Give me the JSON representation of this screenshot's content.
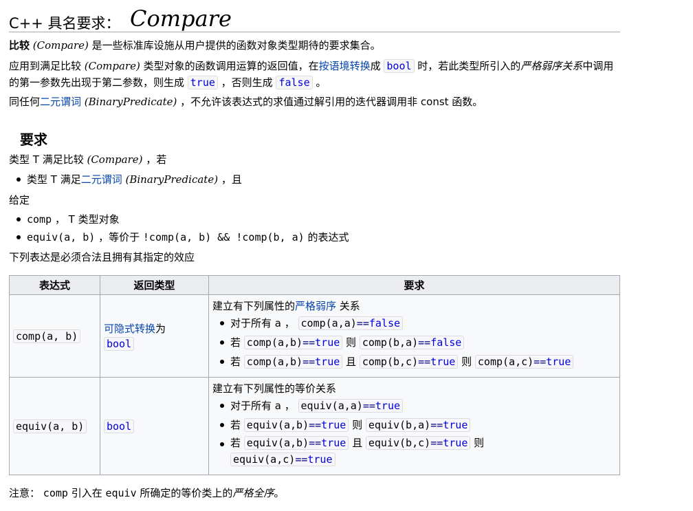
{
  "title": {
    "prefix": "C++ 具名要求：",
    "main": "Compare"
  },
  "intro": {
    "p1_bold": "比较",
    "p1_it": "(Compare)",
    "p1_rest": " 是一些标准库设施从用户提供的函数对象类型期待的要求集合。",
    "p2_a": "应用到满足比较 ",
    "p2_it": "(Compare)",
    "p2_b": " 类型对象的函数调用运算的返回值，在",
    "p2_link": "按语境转换",
    "p2_c": "成 ",
    "p2_bool": "bool",
    "p2_d": " 时，若此类型所引入的",
    "p2_em": "严格弱序关系",
    "p2_e": "中调用的第一参数先出现于第二参数，则生成 ",
    "p2_true": "true",
    "p2_f": " ，否则生成 ",
    "p2_false": "false",
    "p2_g": " 。",
    "p3_a": "同任何",
    "p3_link": "二元谓词",
    "p3_it": " (BinaryPredicate)",
    "p3_b": " ，不允许该表达式的求值通过解引用的迭代器调用非 const 函数。"
  },
  "requirements": {
    "heading": "要求",
    "line1_a": "类型 T 满足比较 ",
    "line1_it": "(Compare)",
    "line1_b": " ，若",
    "bullet1_a": "类型 T 满足",
    "bullet1_link": "二元谓词",
    "bullet1_it": " (BinaryPredicate)",
    "bullet1_b": " ，且",
    "given": "给定",
    "g1_code": "comp",
    "g1_text": " ， T 类型对象",
    "g2_code": "equiv(a, b)",
    "g2_text": " ，等价于 ",
    "g2_code2": "!comp(a, b) && !comp(b, a)",
    "g2_tail": " 的表达式",
    "lead": "下列表达是必须合法且拥有其指定的效应"
  },
  "table": {
    "headers": [
      "表达式",
      "返回类型",
      "要求"
    ],
    "row1": {
      "expr_fn": "comp",
      "expr_args": "(a, b)",
      "ret_link": "可隐式转换",
      "ret_tail": "为",
      "ret_type": "bool",
      "lead_a": "建立有下列属性的",
      "lead_link": "严格弱序",
      "lead_b": " 关系",
      "i1_text": "对于所有 a ，",
      "i1_fn": "comp",
      "i1_args": "(a,a)",
      "i1_op": "==",
      "i1_val": "false",
      "i2_pre": "若",
      "i2_fn": "comp",
      "i2_args": "(a,b)",
      "i2_op": "==",
      "i2_val": "true",
      "i2_mid": "则",
      "i2_fn2": "comp",
      "i2_args2": "(b,a)",
      "i2_op2": "==",
      "i2_val2": "false",
      "i3_pre": "若",
      "i3_fn": "comp",
      "i3_args": "(a,b)",
      "i3_op": "==",
      "i3_val": "true",
      "i3_mid": "且",
      "i3_fn2": "comp",
      "i3_args2": "(b,c)",
      "i3_op2": "==",
      "i3_val2": "true",
      "i3_mid2": "则",
      "i3_fn3": "comp",
      "i3_args3": "(a,c)",
      "i3_op3": "==",
      "i3_val3": "true"
    },
    "row2": {
      "expr_fn": "equiv",
      "expr_args": "(a, b)",
      "ret_type": "bool",
      "lead": "建立有下列属性的等价关系",
      "i1_text": "对于所有 a ，",
      "i1_fn": "equiv",
      "i1_args": "(a,a)",
      "i1_op": "==",
      "i1_val": "true",
      "i2_pre": "若",
      "i2_fn": "equiv",
      "i2_args": "(a,b)",
      "i2_op": "==",
      "i2_val": "true",
      "i2_mid": "则",
      "i2_fn2": "equiv",
      "i2_args2": "(b,a)",
      "i2_op2": "==",
      "i2_val2": "true",
      "i3_pre": "若",
      "i3_fn": "equiv",
      "i3_args": "(a,b)",
      "i3_op": "==",
      "i3_val": "true",
      "i3_mid": "且",
      "i3_fn2": "equiv",
      "i3_args2": "(b,c)",
      "i3_op2": "==",
      "i3_val2": "true",
      "i3_mid2": "则",
      "i3_fn3": "equiv",
      "i3_args3": "(a,c)",
      "i3_op3": "==",
      "i3_val3": "true"
    }
  },
  "note": {
    "a": "注意：",
    "code1": "comp",
    "b": " 引入在 ",
    "code2": "equiv",
    "c": " 所确定的等价类上的",
    "em": "严格全序",
    "d": "。"
  },
  "colors": {
    "link": "#0645ad",
    "keyword": "#0000dd",
    "operator": "#000080",
    "table_border": "#a2a9b1",
    "header_bg": "#eaecf0"
  }
}
